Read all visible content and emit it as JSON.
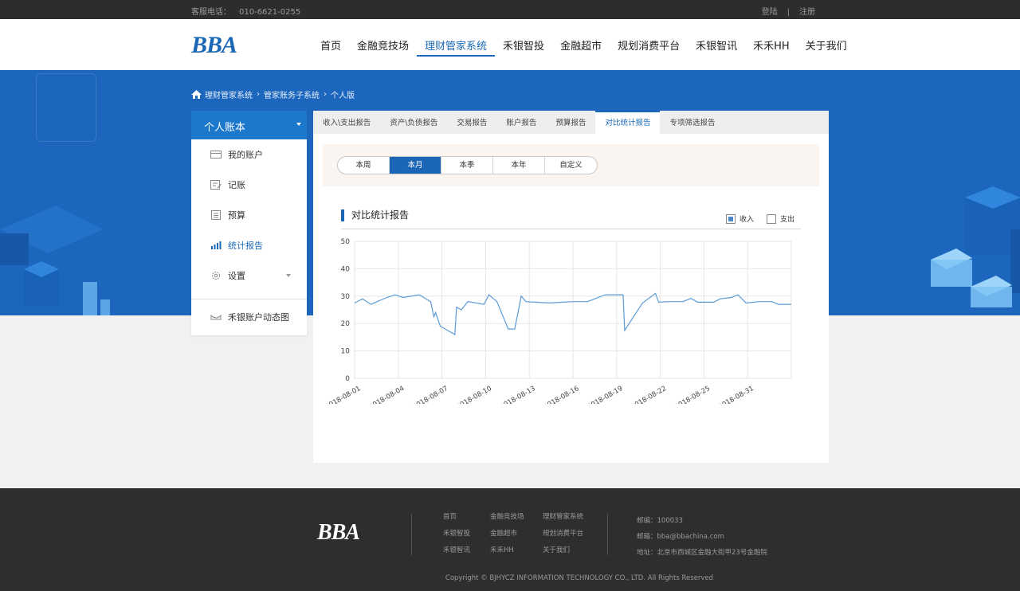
{
  "topbar": {
    "hotline_label": "客服电话：",
    "hotline": "010-6621-0255",
    "login": "登陆",
    "sep": "|",
    "register": "注册"
  },
  "brand": {
    "logo": "BBA"
  },
  "nav": [
    "首页",
    "金融竞技场",
    "理财管家系统",
    "禾银智投",
    "金融超市",
    "规划消费平台",
    "禾银智讯",
    "禾禾HH",
    "关于我们"
  ],
  "nav_active": 2,
  "breadcrumb": [
    "理财管家系统",
    "管家账务子系统",
    "个人版"
  ],
  "sidebar": {
    "header": "个人账本",
    "items": [
      {
        "label": "我的账户",
        "icon": "card-icon"
      },
      {
        "label": "记账",
        "icon": "notebook-icon"
      },
      {
        "label": "预算",
        "icon": "calculator-icon"
      },
      {
        "label": "统计报告",
        "icon": "bar-chart-icon"
      },
      {
        "label": "设置",
        "icon": "gear-icon"
      }
    ],
    "bottom": "禾银账户动态图"
  },
  "tabs": [
    "收入\\支出报告",
    "资产\\负债报告",
    "交易报告",
    "账户报告",
    "预算报告",
    "对比统计报告",
    "专项筛选报告"
  ],
  "tab_active": 5,
  "periods": [
    "本周",
    "本月",
    "本季",
    "本年",
    "自定义"
  ],
  "period_active": 1,
  "chart_title": "对比统计报告",
  "legend": {
    "income": "收入",
    "expense": "支出"
  },
  "chart_data": {
    "type": "line",
    "title": "对比统计报告",
    "ylim": [
      0,
      50
    ],
    "yticks": [
      0,
      10,
      20,
      30,
      40,
      50
    ],
    "xticks": [
      "2018-08-01",
      "2018-08-04",
      "2018-08-07",
      "2018-08-10",
      "2018-08-13",
      "2018-08-16",
      "2018-08-19",
      "2018-08-22",
      "2018-08-25",
      "2018-08-31"
    ],
    "grid": true,
    "legend_position": "top-right",
    "series": [
      {
        "name": "收入",
        "color": "#5b9bd5",
        "points": [
          [
            0,
            27.5
          ],
          [
            0.5,
            29
          ],
          [
            1,
            27
          ],
          [
            2,
            29.5
          ],
          [
            2.5,
            30.5
          ],
          [
            3,
            29.5
          ],
          [
            4,
            30.5
          ],
          [
            4.7,
            28
          ],
          [
            4.9,
            22.5
          ],
          [
            5,
            24
          ],
          [
            5.3,
            19
          ],
          [
            6.2,
            16
          ],
          [
            6.3,
            26
          ],
          [
            6.6,
            25
          ],
          [
            7,
            28
          ],
          [
            8,
            27
          ],
          [
            8.3,
            30.5
          ],
          [
            8.8,
            28
          ],
          [
            9.5,
            18
          ],
          [
            9.9,
            18
          ],
          [
            10.3,
            30
          ],
          [
            10.6,
            28
          ],
          [
            12,
            27.5
          ],
          [
            13.5,
            28
          ],
          [
            14.4,
            28
          ],
          [
            15.5,
            30.5
          ],
          [
            16.6,
            30.5
          ],
          [
            16.7,
            17.5
          ],
          [
            17.8,
            27.5
          ],
          [
            18.6,
            31
          ],
          [
            18.8,
            27.8
          ],
          [
            19.4,
            28
          ],
          [
            20.3,
            28
          ],
          [
            20.8,
            29.2
          ],
          [
            21.2,
            27.8
          ],
          [
            22.2,
            27.8
          ],
          [
            22.6,
            29
          ],
          [
            23.3,
            29.5
          ],
          [
            23.7,
            30.5
          ],
          [
            24.2,
            27.5
          ],
          [
            25,
            28
          ],
          [
            25.8,
            28
          ],
          [
            26.2,
            27
          ],
          [
            27,
            27
          ]
        ]
      },
      {
        "name": "支出",
        "color": "#ffffff",
        "points": []
      }
    ],
    "x_domain": [
      0,
      27
    ]
  },
  "footer": {
    "logo": "BBA",
    "links": [
      "首页",
      "金融竞技场",
      "理财管家系统",
      "禾银智投",
      "金融超市",
      "规划消费平台",
      "禾银智讯",
      "禾禾HH",
      "关于我们"
    ],
    "postcode": "邮编：100033",
    "email": "邮箱：bba@bbachina.com",
    "address": "地址：北京市西城区金融大街甲23号金融院",
    "copyright": "Copyright © BJHYCZ  INFORMATION TECHNOLOGY  CO., LTD. All Rights Reserved"
  }
}
